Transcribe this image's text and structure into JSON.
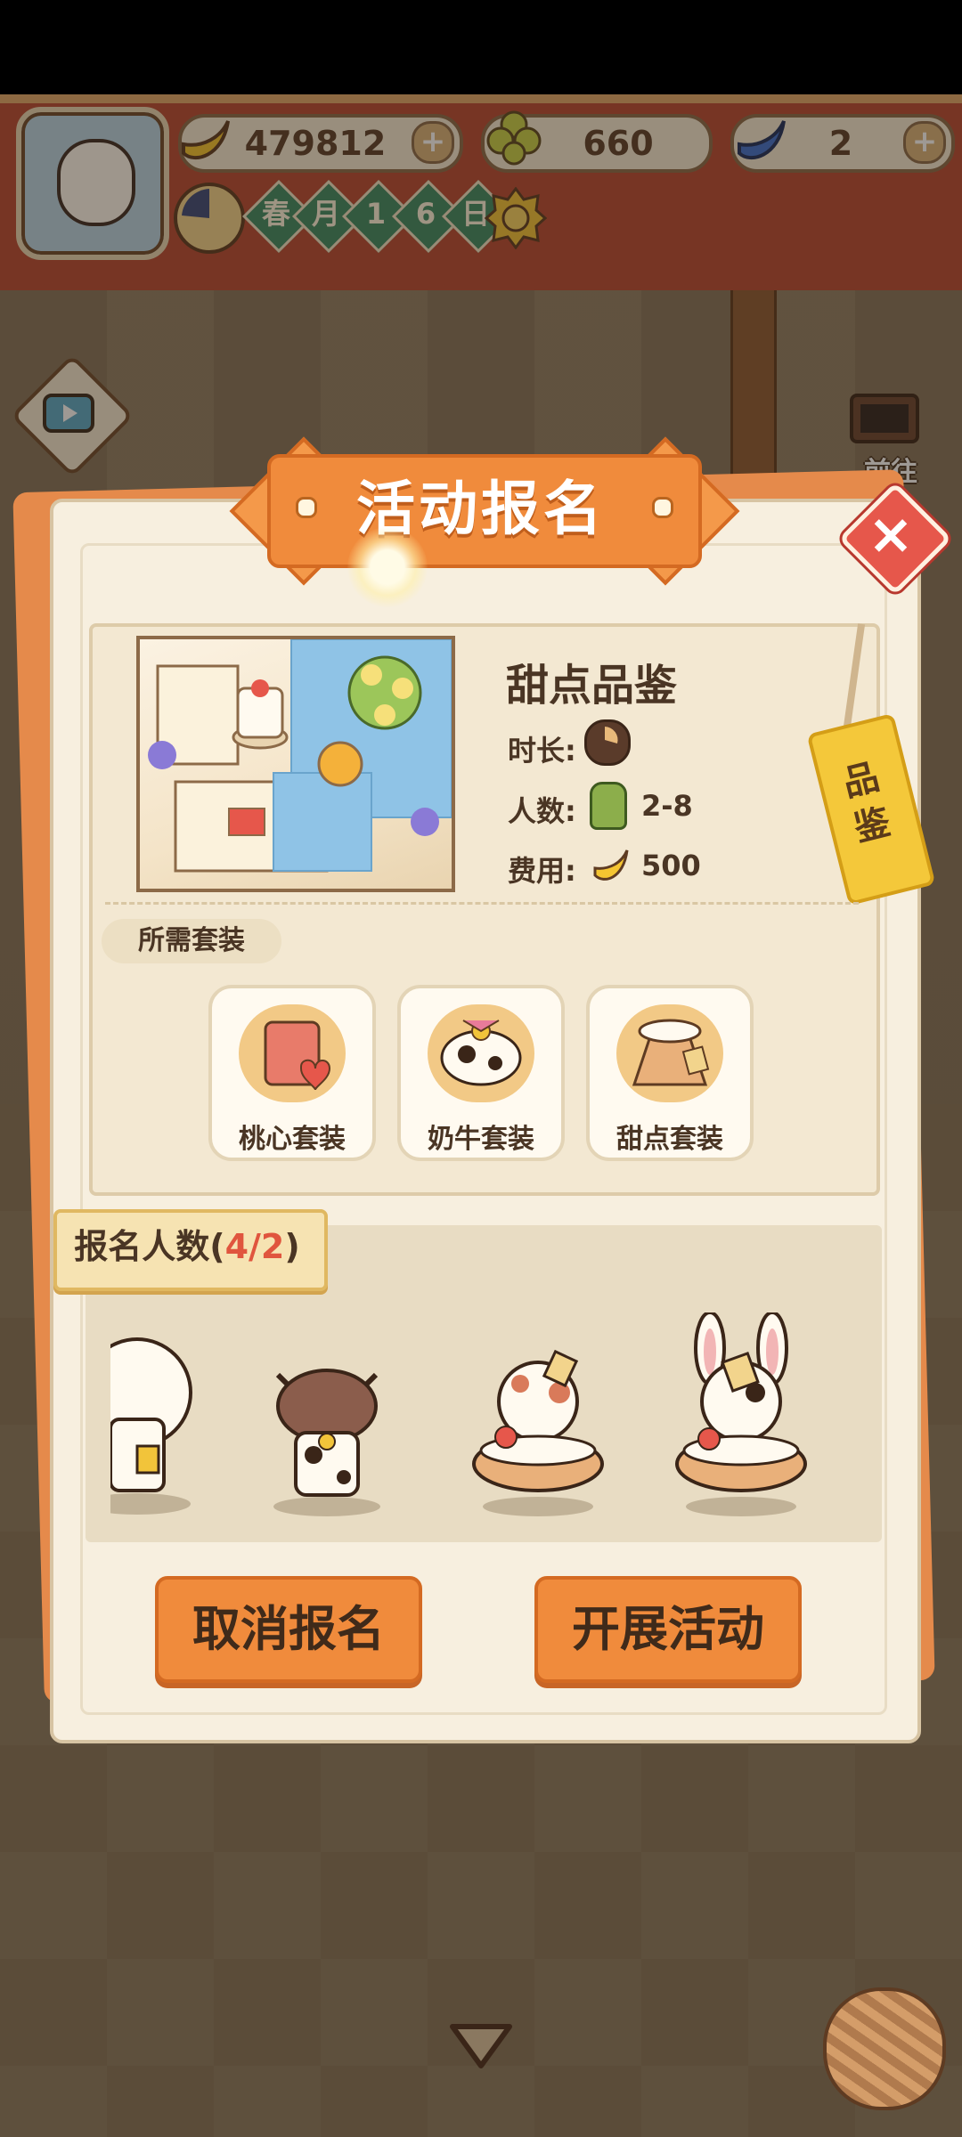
{
  "hud": {
    "bananas": "479812",
    "clovers": "660",
    "gems": "2",
    "date_chars": [
      "春",
      "月",
      "1",
      "6",
      "日"
    ]
  },
  "side": {
    "goto_label": "前往"
  },
  "dialog": {
    "title": "活动报名",
    "activity": {
      "name": "甜点品鉴",
      "duration_label": "时长:",
      "people_label": "人数:",
      "people_value": "2-8",
      "cost_label": "费用:",
      "cost_value": "500",
      "tag": "品鉴"
    },
    "required_suits_label": "所需套装",
    "suits": [
      {
        "name": "桃心套装",
        "icon": "peach-heart-outfit-icon"
      },
      {
        "name": "奶牛套装",
        "icon": "cow-outfit-icon"
      },
      {
        "name": "甜点套装",
        "icon": "dessert-outfit-icon"
      }
    ],
    "registration": {
      "label_prefix": "报名人数(",
      "count": "4/2",
      "label_suffix": ")"
    },
    "buttons": {
      "cancel": "取消报名",
      "start": "开展活动"
    }
  },
  "colors": {
    "accent_orange": "#f08b3c",
    "panel_bg": "#f7efdf",
    "count_red": "#e0553e"
  }
}
